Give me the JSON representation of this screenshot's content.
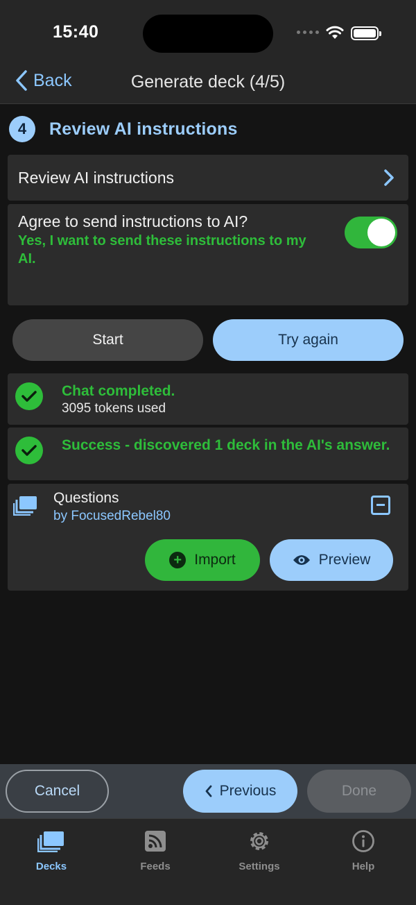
{
  "status_bar": {
    "time": "15:40"
  },
  "nav": {
    "back_label": "Back",
    "title": "Generate deck (4/5)"
  },
  "step": {
    "number": "4",
    "title": "Review AI instructions"
  },
  "review_row": {
    "label": "Review AI instructions"
  },
  "agree": {
    "question": "Agree to send instructions to AI?",
    "answer": "Yes, I want to send these instructions to my AI.",
    "toggle_on": true
  },
  "buttons": {
    "start": "Start",
    "try_again": "Try again"
  },
  "chat_status": {
    "title": "Chat completed.",
    "subtitle": "3095 tokens used"
  },
  "success_status": {
    "title": "Success - discovered 1 deck in the AI's answer."
  },
  "deck": {
    "title": "Questions",
    "author": "by FocusedRebel80",
    "import_label": "Import",
    "preview_label": "Preview"
  },
  "actions": {
    "cancel": "Cancel",
    "previous": "Previous",
    "done": "Done"
  },
  "tabs": [
    {
      "label": "Decks",
      "icon": "decks-icon",
      "active": true
    },
    {
      "label": "Feeds",
      "icon": "rss-icon",
      "active": false
    },
    {
      "label": "Settings",
      "icon": "gear-icon",
      "active": false
    },
    {
      "label": "Help",
      "icon": "info-icon",
      "active": false
    }
  ],
  "colors": {
    "accent": "#9ccdfb",
    "link": "#8cc7ff",
    "success": "#2ebd3a",
    "background": "#141414",
    "card": "#2c2c2c"
  }
}
